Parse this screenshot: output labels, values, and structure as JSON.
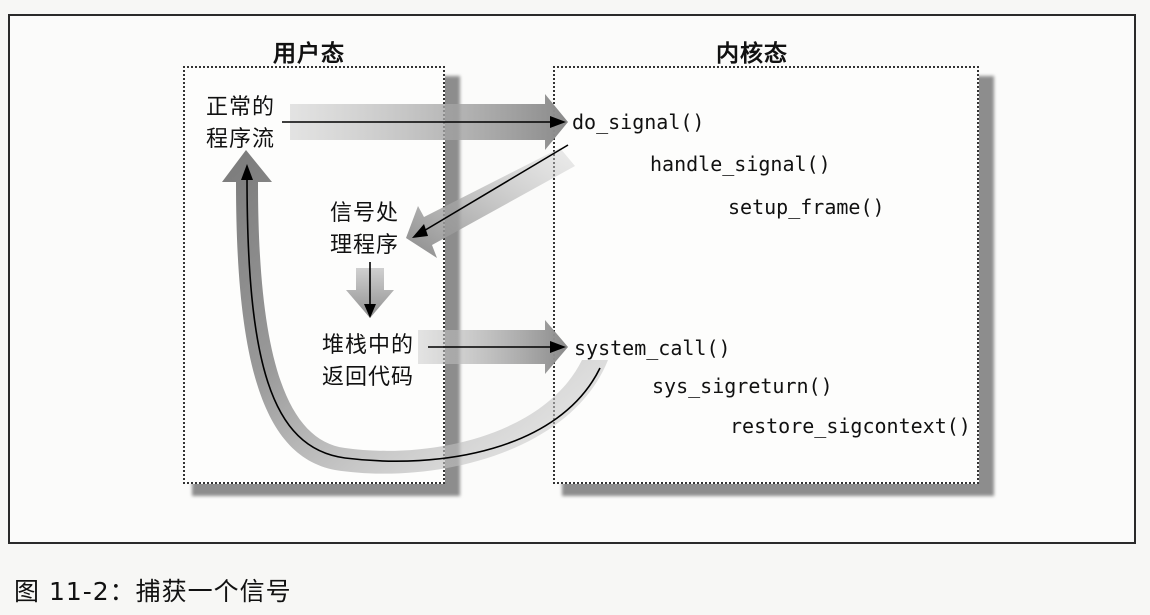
{
  "user_mode": {
    "title": "用户态",
    "normal_flow": [
      "正常的",
      "程序流"
    ],
    "signal_handler": [
      "信号处",
      "理程序"
    ],
    "stack_return_code": [
      "堆栈中的",
      "返回代码"
    ]
  },
  "kernel_mode": {
    "title": "内核态",
    "calls": {
      "do_signal": "do_signal()",
      "handle_signal": "handle_signal()",
      "setup_frame": "setup_frame()",
      "system_call": "system_call()",
      "sys_sigreturn": "sys_sigreturn()",
      "restore_sigcontext": "restore_sigcontext()"
    }
  },
  "caption": "图 11-2：捕获一个信号"
}
